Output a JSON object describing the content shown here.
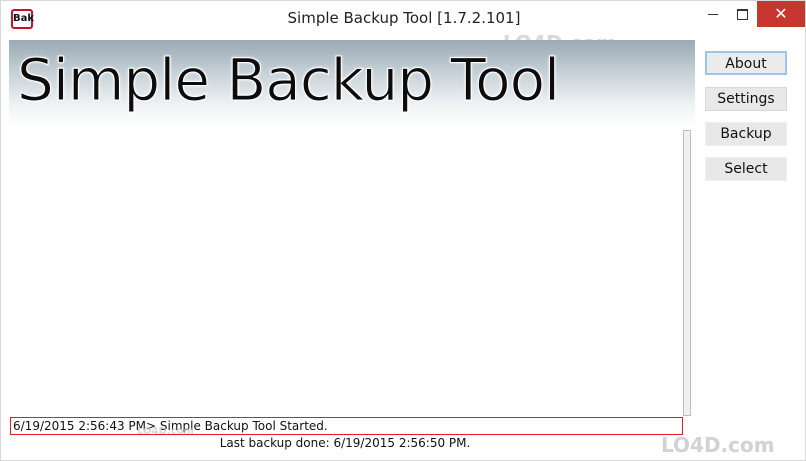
{
  "window": {
    "icon_text": "Bak",
    "title": "Simple Backup Tool [1.7.2.101]",
    "close_glyph": "✕"
  },
  "banner": {
    "title": "Simple Backup Tool"
  },
  "buttons": {
    "about": "About",
    "settings": "Settings",
    "backup": "Backup",
    "select": "Select"
  },
  "log": {
    "lines": [
      "6/19/2015 2:56:43 PM> Simple Backup Tool Started."
    ]
  },
  "status": {
    "text": "Last backup done: 6/19/2015 2:56:50 PM."
  },
  "watermark": {
    "text": "LO4D.com"
  },
  "colors": {
    "close_button": "#c7372f",
    "log_line_border": "#e02020",
    "focused_button_border": "#9dc4ea"
  }
}
